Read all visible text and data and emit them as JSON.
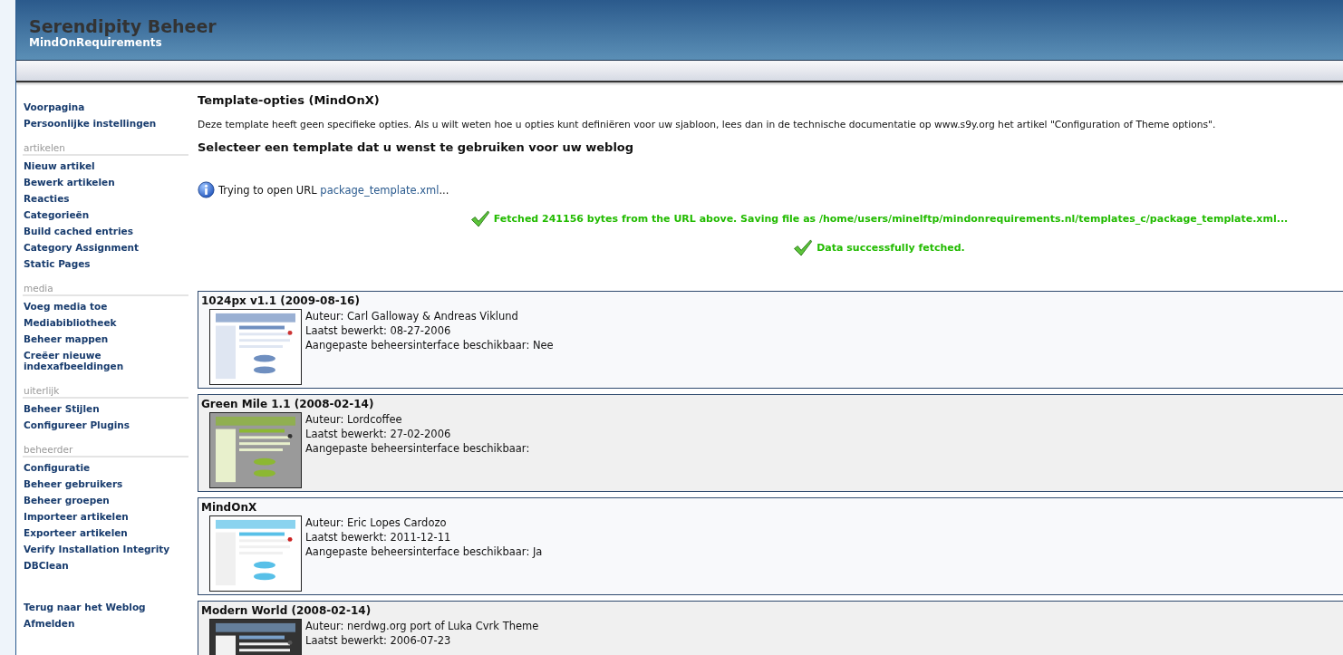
{
  "header": {
    "title": "Serendipity Beheer",
    "subtitle": "MindOnRequirements"
  },
  "sidebar": {
    "groups": [
      {
        "items": [
          "Voorpagina",
          "Persoonlijke instellingen"
        ]
      },
      {
        "heading": "artikelen",
        "items": [
          "Nieuw artikel",
          "Bewerk artikelen",
          "Reacties",
          "Categorieën",
          "Build cached entries",
          "Category Assignment",
          "Static Pages"
        ]
      },
      {
        "heading": "media",
        "items": [
          "Voeg media toe",
          "Mediabibliotheek",
          "Beheer mappen",
          "Creëer nieuwe indexafbeeldingen"
        ]
      },
      {
        "heading": "uiterlijk",
        "items": [
          "Beheer Stijlen",
          "Configureer Plugins"
        ]
      },
      {
        "heading": "beheerder",
        "items": [
          "Configuratie",
          "Beheer gebruikers",
          "Beheer groepen",
          "Importeer artikelen",
          "Exporteer artikelen",
          "Verify Installation Integrity",
          "DBClean"
        ]
      },
      {
        "items": [
          "Terug naar het Weblog",
          "Afmelden"
        ]
      }
    ]
  },
  "main": {
    "options_title": "Template-opties (MindOnX)",
    "options_text": "Deze template heeft geen specifieke opties. Als u wilt weten hoe u opties kunt definiëren voor uw sjabloon, lees dan in de technische documentatie op www.s9y.org het artikel \"Configuration of Theme options\".",
    "select_title": "Selecteer een template dat u wenst te gebruiken voor uw weblog",
    "messages": [
      {
        "kind": "info",
        "text": "Trying to open URL ",
        "link": "package_template.xml",
        "suffix": "..."
      },
      {
        "kind": "success",
        "text": "Fetched 241156 bytes from the URL above. Saving file as /home/users/minelftp/mindonrequirements.nl/templates_c/package_template.xml..."
      },
      {
        "kind": "success",
        "text": "Data successfully fetched."
      }
    ],
    "templates": [
      {
        "title": "1024px v1.1 (2009-08-16)",
        "thumbnail": {
          "kind": "picture"
        },
        "lines": [
          "Auteur: Carl Galloway & Andreas Viklund",
          "Laatst bewerkt: 08-27-2006",
          "Aangepaste beheersinterface beschikbaar: Nee"
        ]
      },
      {
        "title": "Green Mile 1.1 (2008-02-14)",
        "thumbnail": {
          "kind": "picture"
        },
        "lines": [
          "Auteur: Lordcoffee",
          "Laatst bewerkt: 27-02-2006",
          "Aangepaste beheersinterface beschikbaar:"
        ]
      },
      {
        "title": "MindOnX",
        "thumbnail": {
          "kind": "picture"
        },
        "lines": [
          "Auteur: Eric Lopes Cardozo",
          "Laatst bewerkt: 2011-12-11",
          "Aangepaste beheersinterface beschikbaar: Ja"
        ]
      },
      {
        "title": "Modern World (2008-02-14)",
        "thumbnail": {
          "kind": "picture"
        },
        "lines": [
          "Auteur: nerdwg.org port of Luka Cvrk Theme",
          "Laatst bewerkt: 2006-07-23"
        ]
      }
    ]
  }
}
